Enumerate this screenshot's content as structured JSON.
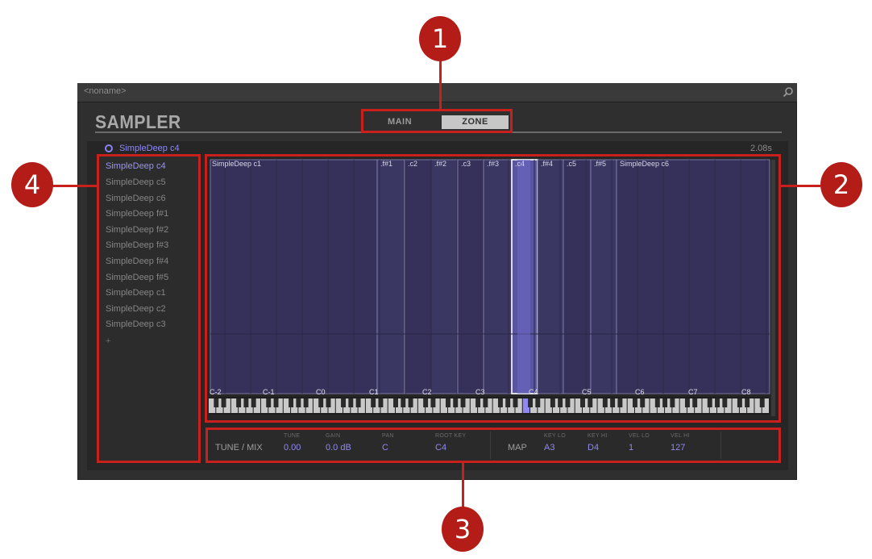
{
  "window": {
    "title": "<noname>",
    "search_icon": "magnifier-icon"
  },
  "header": {
    "title": "SAMPLER",
    "tabs": [
      {
        "label": "MAIN",
        "active": false
      },
      {
        "label": "ZONE",
        "active": true
      }
    ]
  },
  "selected_sample": {
    "name": "SimpleDeep c4",
    "duration": "2.08s"
  },
  "zone_list": {
    "items": [
      "SimpleDeep c4",
      "SimpleDeep c5",
      "SimpleDeep c6",
      "SimpleDeep f#1",
      "SimpleDeep f#2",
      "SimpleDeep f#3",
      "SimpleDeep f#4",
      "SimpleDeep f#5",
      "SimpleDeep c1",
      "SimpleDeep c2",
      "SimpleDeep c3"
    ],
    "selected_index": 0,
    "add_label": "+"
  },
  "zone_map": {
    "zone_labels": [
      "SimpleDeep c1",
      ".f#1",
      ".c2",
      ".f#2",
      ".c3",
      ".f#3",
      ".c4",
      ".f#4",
      ".c5",
      ".f#5",
      "SimpleDeep c6"
    ],
    "octave_labels": [
      "C-2",
      "C-1",
      "C0",
      "C1",
      "C2",
      "C3",
      "C4",
      "C5",
      "C6",
      "C7",
      "C8"
    ],
    "selected_zone": ".c4",
    "accent_color": "#8f88f0"
  },
  "tune_mix": {
    "title": "TUNE / MIX",
    "params": [
      {
        "label": "TUNE",
        "value": "0.00"
      },
      {
        "label": "GAIN",
        "value": "0.0 dB"
      },
      {
        "label": "PAN",
        "value": "C"
      },
      {
        "label": "ROOT KEY",
        "value": "C4"
      }
    ]
  },
  "map": {
    "title": "MAP",
    "params": [
      {
        "label": "KEY LO",
        "value": "A3"
      },
      {
        "label": "KEY HI",
        "value": "D4"
      },
      {
        "label": "VEL LO",
        "value": "1"
      },
      {
        "label": "VEL HI",
        "value": "127"
      }
    ]
  },
  "callouts": [
    "1",
    "2",
    "3",
    "4"
  ]
}
